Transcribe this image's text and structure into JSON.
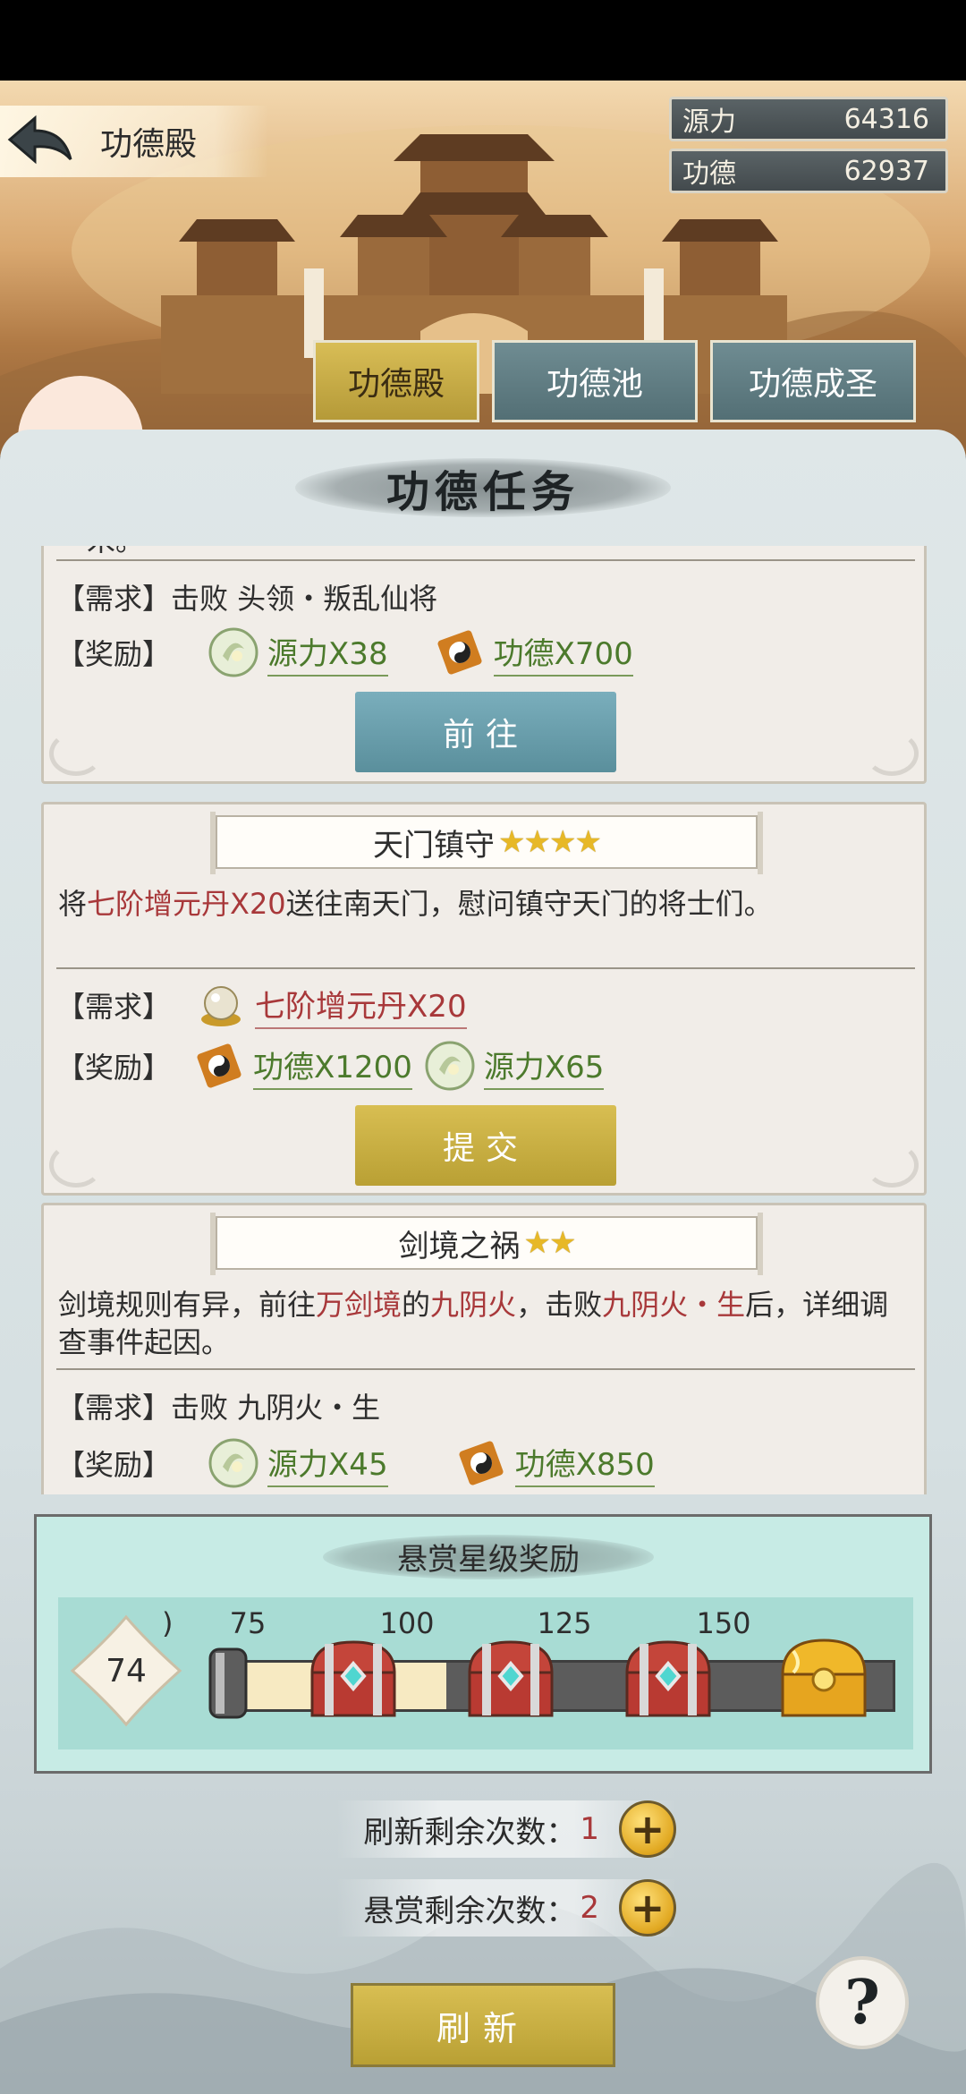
{
  "header": {
    "title": "功德殿",
    "resources": [
      {
        "label": "源力",
        "value": "64316"
      },
      {
        "label": "功德",
        "value": "62937"
      }
    ],
    "tabs": [
      {
        "label": "功德殿",
        "active": true
      },
      {
        "label": "功德池",
        "active": false
      },
      {
        "label": "功德成圣",
        "active": false
      }
    ]
  },
  "section_title": "功德任务",
  "tasks": [
    {
      "desc_fragment": "一米。",
      "requirement": "【需求】击败 头领・叛乱仙将",
      "reward_label": "【奖励】",
      "rewards": [
        {
          "icon": "yuanli-orb-icon",
          "text": "源力X38"
        },
        {
          "icon": "gongde-scroll-icon",
          "text": "功德X700"
        }
      ],
      "button": "前往"
    },
    {
      "title": "天门镇守",
      "stars": "★★★★",
      "star_count": 4,
      "desc_parts": [
        "将",
        "七阶增元丹X20",
        "送往南天门，慰问镇守天门的将士们。"
      ],
      "requirement_label": "【需求】",
      "requirement_item": {
        "icon": "pearl-icon",
        "text": "七阶增元丹X20"
      },
      "reward_label": "【奖励】",
      "rewards": [
        {
          "icon": "gongde-scroll-icon",
          "text": "功德X1200"
        },
        {
          "icon": "yuanli-orb-icon",
          "text": "源力X65"
        }
      ],
      "button": "提交"
    },
    {
      "title": "剑境之祸",
      "stars": "★★",
      "star_count": 2,
      "desc_parts": [
        "剑境规则有异，前往",
        "万剑境",
        "的",
        "九阴火",
        "，击败",
        "九阴火・生",
        "后，详细调查事件起因。"
      ],
      "requirement": "【需求】击败 九阴火・生",
      "reward_label": "【奖励】",
      "rewards": [
        {
          "icon": "yuanli-orb-icon",
          "text": "源力X45"
        },
        {
          "icon": "gongde-scroll-icon",
          "text": "功德X850"
        }
      ]
    }
  ],
  "star_rewards": {
    "title": "悬赏星级奖励",
    "score": "74",
    "progress_fraction": 0.34,
    "milestones": [
      {
        "label": ")",
        "chest": "silver-chest-icon"
      },
      {
        "label": "75",
        "chest": "red-chest-icon"
      },
      {
        "label": "100",
        "chest": "red-chest-icon"
      },
      {
        "label": "125",
        "chest": "red-chest-icon"
      },
      {
        "label": "150",
        "chest": "gold-chest-icon"
      }
    ]
  },
  "counters": [
    {
      "label": "刷新剩余次数：",
      "value": "1"
    },
    {
      "label": "悬赏剩余次数：",
      "value": "2"
    }
  ],
  "refresh_button": "刷新",
  "help_button": "?",
  "colors": {
    "accent_gold": "#d8be52",
    "accent_blue": "#6f9fac",
    "reward_green": "#4c7a2c",
    "highlight_red": "#a8383a"
  }
}
